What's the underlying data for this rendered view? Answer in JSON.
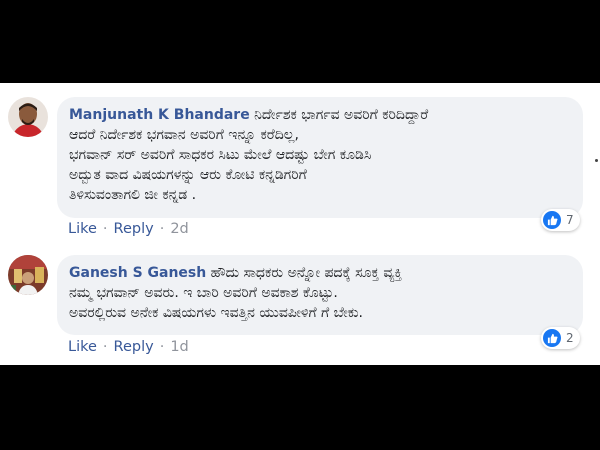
{
  "comments": [
    {
      "author": "Manjunath K Bhandare",
      "text_first": " ನಿರ್ದೇಶಕ ಭಾರ್ಗವ ಅವರಿಗೆ ಕರಿದಿದ್ದಾರೆ",
      "text_lines": [
        "ಆದರೆ ನಿರ್ದೇಶಕ ಭಗವಾನ ಅವರಿಗೆ ಇನ್ನೂ ಕರೆದಿಲ್ಲ,",
        "ಭಗವಾನ್ ಸರ್ ಅವರಿಗೆ ಸಾಧಕರ ಸಿಟು ಮೇಲೆ ಆದಷ್ಟು ಬೇಗ ಕೂಡಿಸಿ",
        "ಅದ್ಬುತ ವಾದ ವಿಷಯಗಳನ್ನು ಆರು ಕೋಟಿ ಕನ್ನಡಿಗರಿಗೆ",
        "ತಿಳಿಸುವಂತಾಗಲಿ ಜೀ ಕನ್ನಡ ."
      ],
      "like_label": "Like",
      "reply_label": "Reply",
      "separator": "·",
      "age": "2d",
      "reaction_count": "7"
    },
    {
      "author": "Ganesh S Ganesh",
      "text_first": " ಹೌದು ಸಾಧಕರು ಅನ್ನೋ ಪದಕ್ಕೆ ಸೂಕ್ತ ವ್ಯಕ್ತಿ",
      "text_lines": [
        "ನಮ್ಮ ಭಗವಾನ್ ಅವರು. ಇ ಬಾರಿ ಅವರಿಗೆ ಅವಕಾಶ ಕೊಟ್ಟು.",
        "ಅವರಲ್ಲಿರುವ ಅನೇಕ ವಿಷಯಗಳು ಇವತ್ತಿನ ಯುವಪೀಳಿಗೆ ಗೆ ಬೇಕು."
      ],
      "like_label": "Like",
      "reply_label": "Reply",
      "separator": "·",
      "age": "1d",
      "reaction_count": "2"
    }
  ],
  "colors": {
    "author": "#385898",
    "bubble": "#f0f2f5",
    "like_blue": "#1877f2",
    "frame": "#000000"
  },
  "icons": [
    "avatar",
    "like-reaction-icon",
    "more-dot-icon"
  ]
}
